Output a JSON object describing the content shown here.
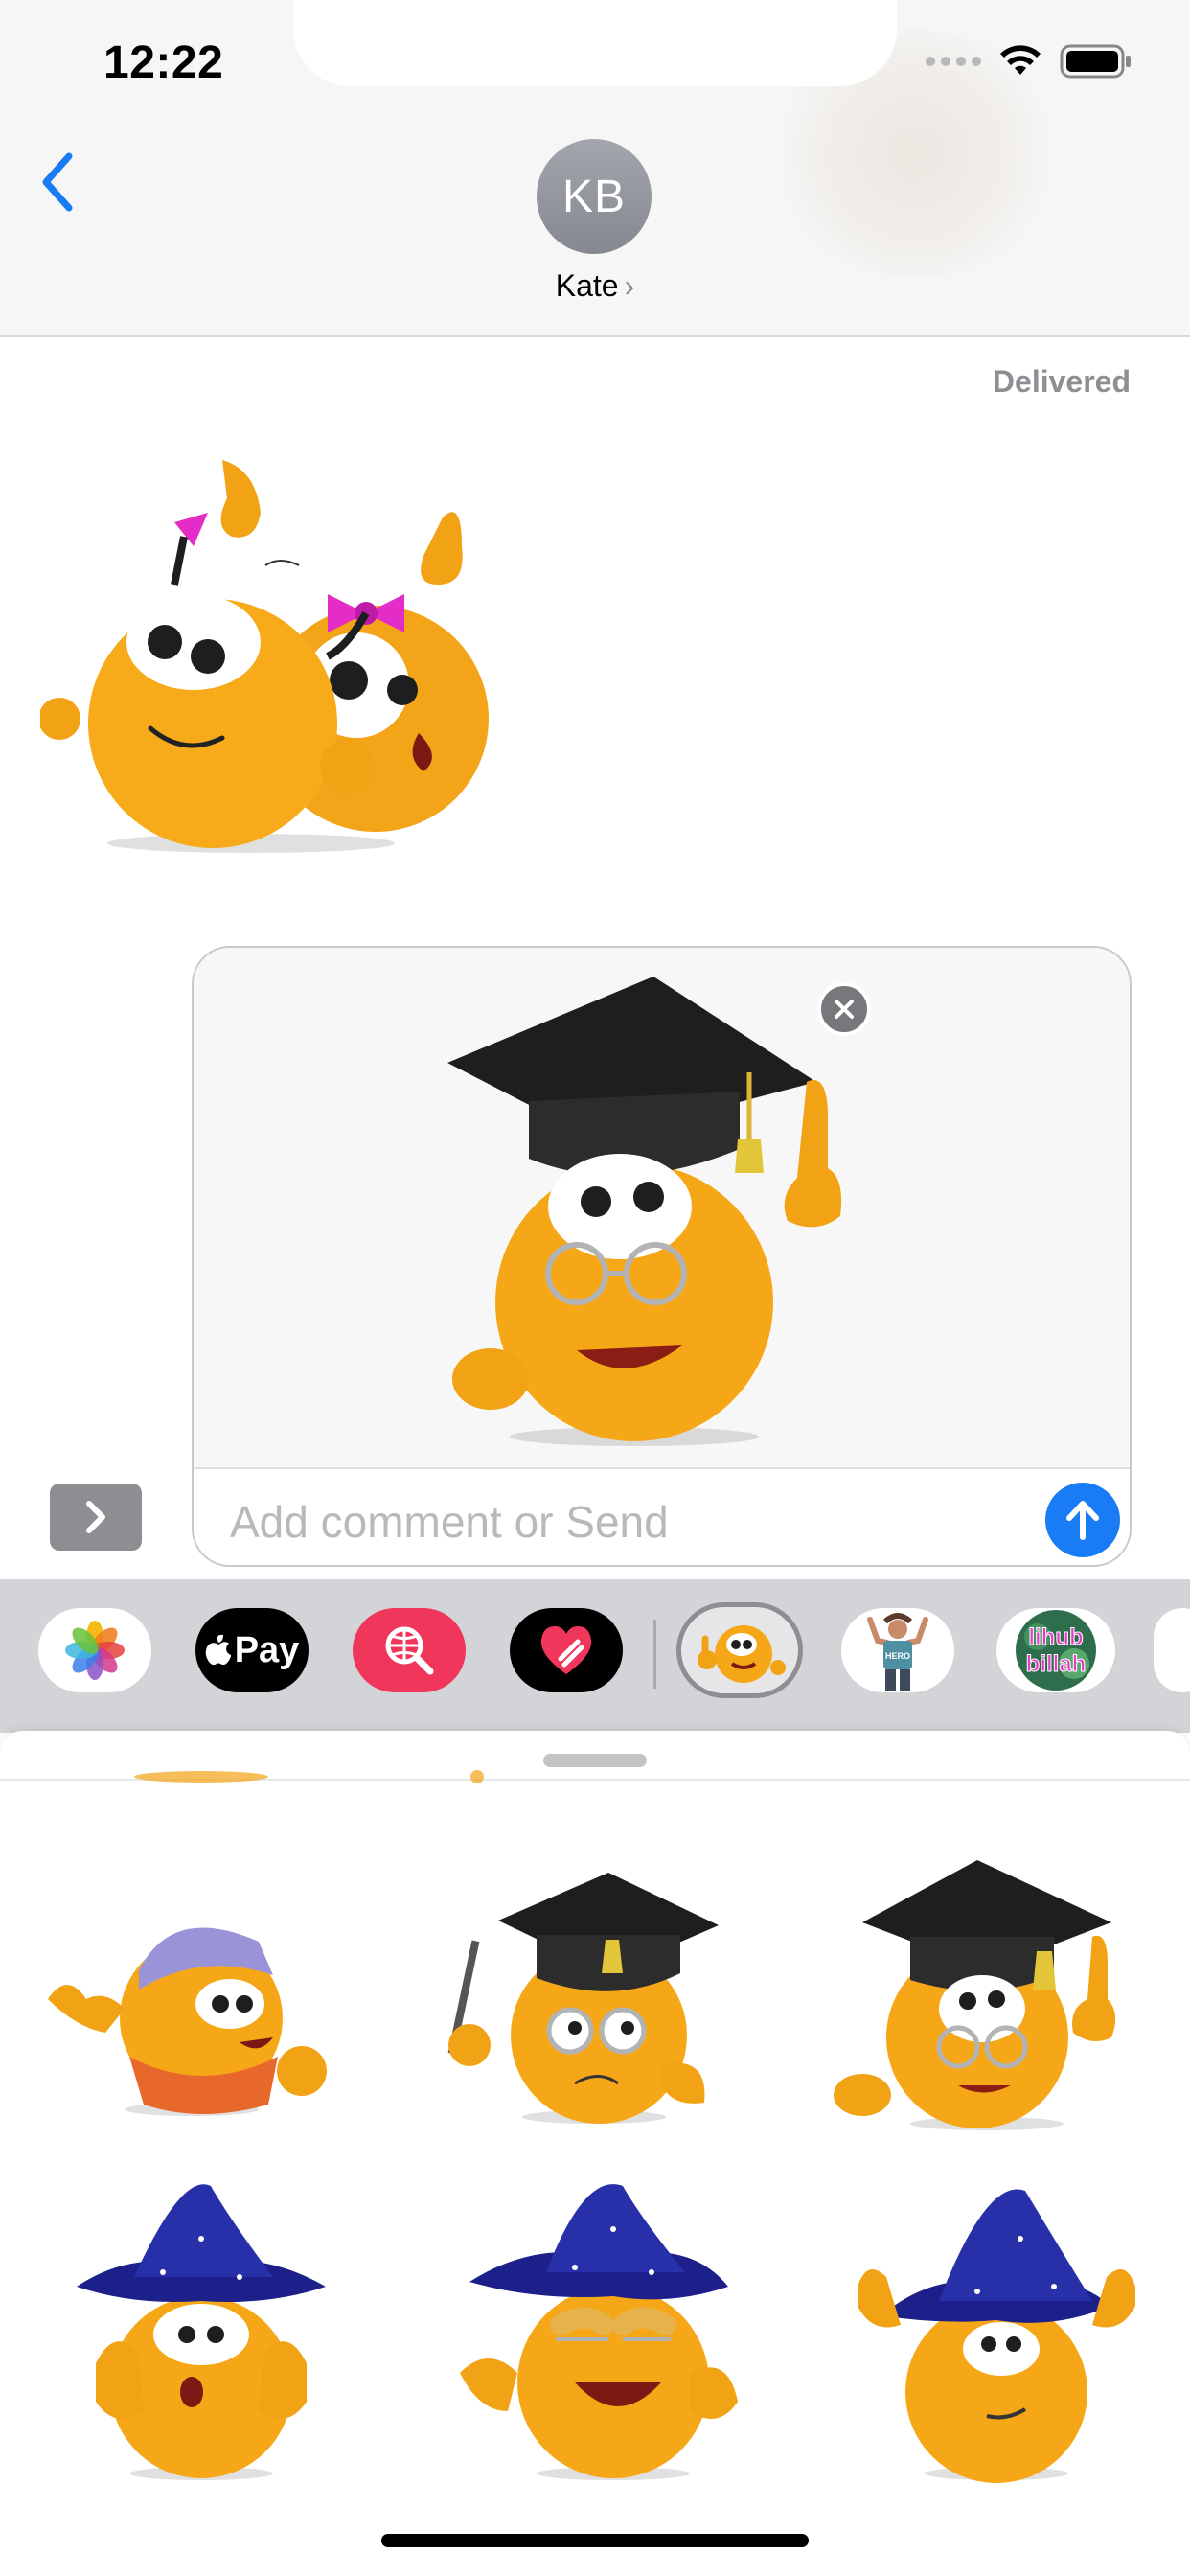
{
  "status_bar": {
    "time": "12:22",
    "icons": [
      "cellular-signal-icon",
      "wifi-icon",
      "battery-icon"
    ]
  },
  "header": {
    "back_icon": "chevron-left-icon",
    "avatar_initials": "KB",
    "contact_name": "Kate",
    "contact_chevron": "›"
  },
  "conversation": {
    "delivered_label": "Delivered",
    "received_sticker": "two-emoji-friends-with-pink-bows-sticker"
  },
  "composer": {
    "preview_sticker": "graduate-emoji-with-mortarboard-sticker",
    "remove_icon": "close-icon",
    "placeholder": "Add comment or Send",
    "send_icon": "arrow-up-icon"
  },
  "expand_button_icon": "chevron-right-icon",
  "app_strip": {
    "apps": [
      {
        "name": "Photos",
        "icon": "photos-icon"
      },
      {
        "name": "Apple Pay",
        "label": "Pay",
        "icon": "apple-pay-icon"
      },
      {
        "name": "Search images",
        "icon": "globe-search-icon"
      },
      {
        "name": "Digital Touch",
        "icon": "heart-touch-icon"
      },
      {
        "name": "Emoji stickers",
        "icon": "emoji-sticker-app-icon",
        "selected": true
      },
      {
        "name": "Hero stickers",
        "label": "HERO",
        "icon": "hero-sticker-app-icon"
      },
      {
        "name": "Lihub Billah stickers",
        "label_line1": "lihub",
        "label_line2": "billah",
        "icon": "lihub-billah-app-icon"
      }
    ]
  },
  "sticker_panel": {
    "stickers": [
      "construction-worker-emoji-sticker",
      "graduate-emoji-reading-sticker",
      "graduate-emoji-pointing-sticker",
      "wizard-emoji-shocked-sticker",
      "wizard-emoji-pointing-sticker",
      "wizard-emoji-hands-up-sticker"
    ]
  },
  "colors": {
    "ios_blue": "#1a7cf5",
    "emoji_orange": "#f6a717",
    "strip_bg": "#d3d4d8",
    "avatar_gray": "#8f9198"
  }
}
